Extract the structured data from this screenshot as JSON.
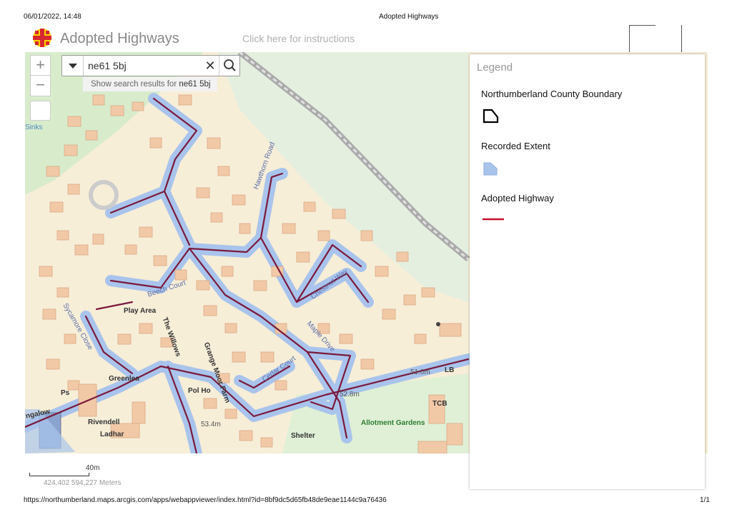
{
  "print": {
    "datetime": "06/01/2022, 14:48",
    "title": "Adopted Highways",
    "url": "https://northumberland.maps.arcgis.com/apps/webappviewer/index.html?id=8bf9dc5d65fb48de9eae1144c9a76436",
    "page": "1/1"
  },
  "header": {
    "title": "Adopted Highways",
    "instructions_link": "Click here for instructions",
    "logo_icon": "northumberland-shield-icon"
  },
  "map_controls": {
    "zoom_in": "+",
    "zoom_out": "−",
    "home_icon": "home-icon"
  },
  "search": {
    "value": "ne61 5bj",
    "clear_icon": "close-icon",
    "search_icon": "search-icon",
    "dropdown_icon": "caret-down-icon",
    "suggestion_prefix": "Show search results for ",
    "suggestion_query": "ne61 5bj"
  },
  "map_labels": {
    "sinks": "Sinks",
    "hawthorn": "Hawthorn Road",
    "chestnut": "Chestnut Way",
    "beech": "Beech Court",
    "play_area": "Play Area",
    "willows": "The Willows",
    "grange": "Grange Moor Farm",
    "maple": "Maple Drive",
    "cedar": "Cedar Court",
    "sycamore": "Sycamore Close",
    "greenlea": "Greenlea",
    "polho": "Pol Ho",
    "rivendell": "Rivendell",
    "ladhar": "Ladhar",
    "bungalow": "ngalow",
    "ps": "Ps",
    "shelter": "Shelter",
    "allotment": "Allotment Gardens",
    "tcb": "TCB",
    "lb": "LB",
    "elev1": "51.0m",
    "elev2": "52.8m",
    "elev3": "53.4m"
  },
  "scale": {
    "label": "40m",
    "coordinates": "424,402 594,227 Meters"
  },
  "legend": {
    "title": "Legend",
    "items": [
      {
        "label": "Northumberland County Boundary",
        "symbol": "polygon-outline"
      },
      {
        "label": "Recorded Extent",
        "symbol": "polygon-fill"
      },
      {
        "label": "Adopted Highway",
        "symbol": "line"
      }
    ],
    "colors": {
      "boundary": "#000000",
      "recorded_extent": "#a9c4ec",
      "adopted_highway": "#c8102e"
    }
  },
  "colors": {
    "map_bg": "#f7eed8",
    "building": "#f2c9a7",
    "road_fill": "#a9c4ec",
    "highway": "#7a1a3c",
    "green": "#c9e6c8",
    "rail": "#bdbdbd"
  }
}
